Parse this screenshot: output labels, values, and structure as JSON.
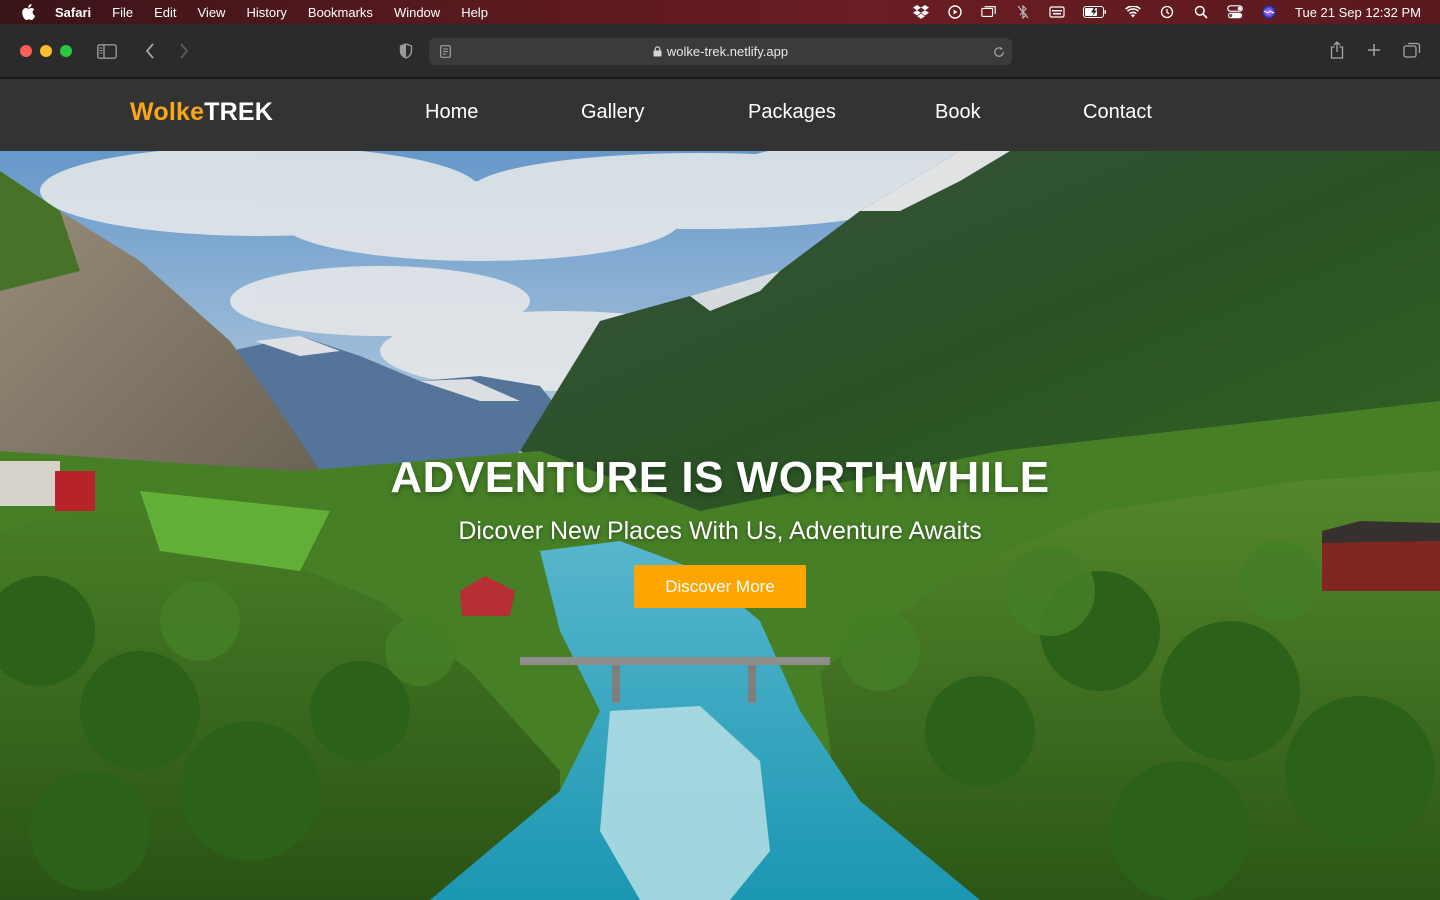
{
  "menubar": {
    "app_name": "Safari",
    "items": [
      "File",
      "Edit",
      "View",
      "History",
      "Bookmarks",
      "Window",
      "Help"
    ],
    "clock": "Tue 21 Sep  12:32 PM",
    "status_icons": [
      "dropbox-icon",
      "play-circle-icon",
      "screens-icon",
      "bluetooth-off-icon",
      "keyboard-icon",
      "battery-charging-icon",
      "wifi-icon",
      "time-machine-icon",
      "search-icon",
      "control-center-icon",
      "siri-icon"
    ]
  },
  "browser": {
    "url": "wolke-trek.netlify.app"
  },
  "site": {
    "logo_part1": "Wolke",
    "logo_part2": "TREK",
    "nav": [
      "Home",
      "Gallery",
      "Packages",
      "Book",
      "Contact"
    ],
    "accent_color": "#f7a718",
    "nav_bg": "#333333"
  },
  "hero": {
    "title": "ADVENTURE IS WORTHWHILE",
    "subtitle": "Dicover New Places With Us, Adventure Awaits",
    "button_label": "Discover More",
    "button_color": "#ffa500"
  }
}
